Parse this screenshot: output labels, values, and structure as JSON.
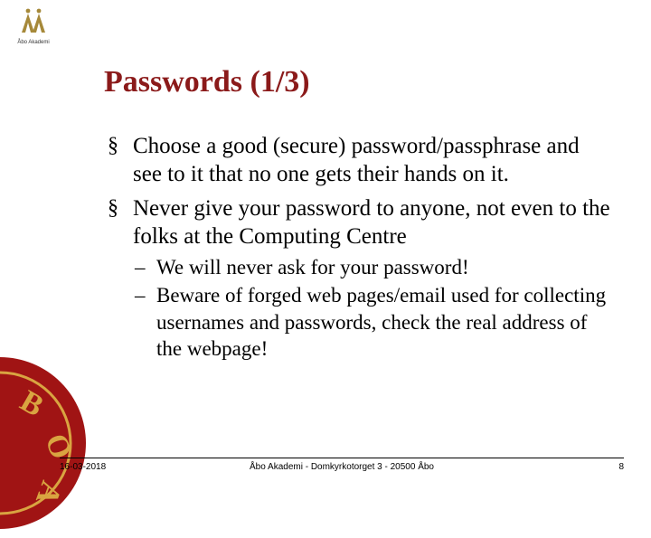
{
  "logo": {
    "caption": "Åbo Akademi"
  },
  "title": "Passwords (1/3)",
  "bullets": [
    {
      "text": "Choose a good (secure) password/passphrase and see to it that no one gets their hands on it.",
      "sub": []
    },
    {
      "text": "Never give your password to anyone, not even to the folks at the Computing Centre",
      "sub": [
        "We will never ask for your password!",
        "Beware of forged web pages/email used for collecting usernames and passwords, check the real address of the webpage!"
      ]
    }
  ],
  "footer": {
    "date": "16-03-2018",
    "center": "Åbo Akademi - Domkyrkotorget 3 - 20500 Åbo",
    "page": "8"
  },
  "colors": {
    "accent": "#8b1a1a"
  }
}
